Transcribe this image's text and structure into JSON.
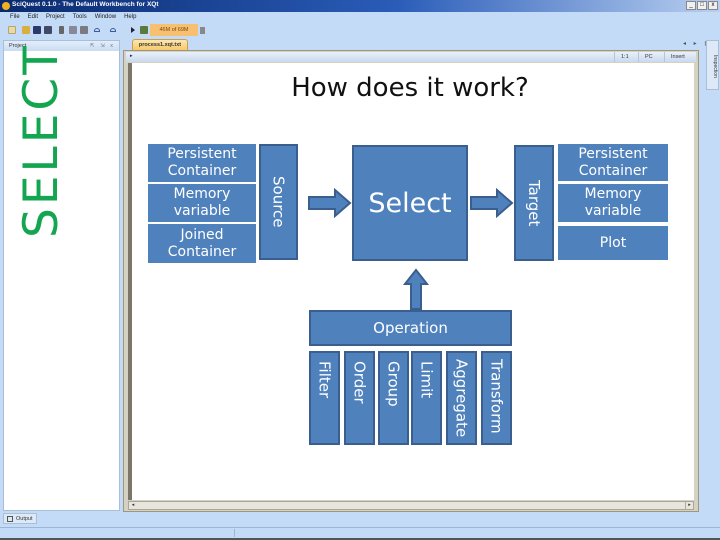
{
  "window": {
    "title": "SciQuest 0.1.0 - The Default Workbench for XQt",
    "controls": [
      "_",
      "□",
      "x"
    ]
  },
  "menu": [
    "File",
    "Edit",
    "Project",
    "Tools",
    "Window",
    "Help"
  ],
  "toolbar": {
    "memory_label": "46M of 69M",
    "icons": [
      "new-icon",
      "open-icon",
      "save-icon",
      "save-all-icon",
      "cut-icon",
      "copy-icon",
      "paste-icon",
      "undo-icon",
      "redo-icon",
      "run-icon",
      "deploy-icon",
      "garbage-collect-icon"
    ]
  },
  "project_panel": {
    "title": "Project",
    "controls": "⇱ ⇲ x",
    "slide_label": "SELECT"
  },
  "editor": {
    "tab_label": "process1.xqt.txt",
    "status": {
      "position": "1:1",
      "encoding": "PC",
      "mode": "Insert"
    },
    "tab_nav": "◂ ▸ ▤"
  },
  "inspection_tab": {
    "label": "Inspection"
  },
  "output_tab": {
    "label": "Output"
  },
  "slide": {
    "title": "How does it work?",
    "sources": [
      "Persistent Container",
      "Memory variable",
      "Joined Container"
    ],
    "source_label": "Source",
    "center_label": "Select",
    "target_label": "Target",
    "targets": [
      "Persistent Container",
      "Memory variable",
      "Plot"
    ],
    "operation_label": "Operation",
    "operations": [
      "Filter",
      "Order",
      "Group",
      "Limit",
      "Aggregate",
      "Transform"
    ],
    "colors": {
      "box_fill": "#4f81bd",
      "box_border": "#3a5f8f",
      "select_label_color": "#14a550"
    }
  }
}
